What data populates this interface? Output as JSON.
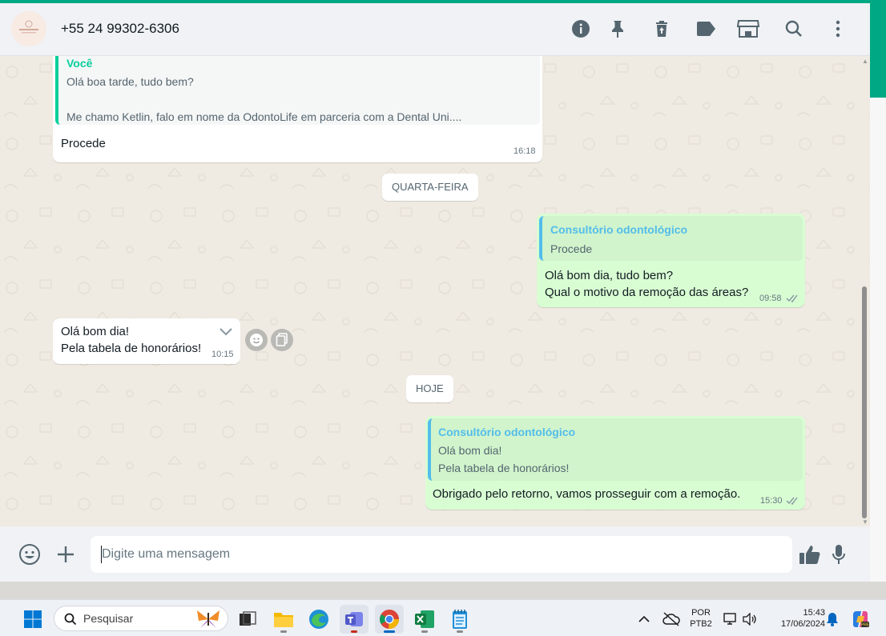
{
  "header": {
    "contact_name": "+55 24 99302-6306",
    "icons": [
      "info-icon",
      "pin-icon",
      "delete-icon",
      "label-icon",
      "store-icon",
      "search-icon",
      "menu-icon"
    ]
  },
  "messages": [
    {
      "id": "m1",
      "direction": "incoming",
      "quote_author": "Você",
      "quote_lines": [
        "Olá boa tarde, tudo bem?",
        "",
        "Me chamo Ketlin, falo em nome da OdontoLife em parceria com a Dental Uni...."
      ],
      "text": [
        "Procede"
      ],
      "time": "16:18"
    },
    {
      "id": "d1",
      "type": "date",
      "label": "QUARTA-FEIRA"
    },
    {
      "id": "m2",
      "direction": "outgoing",
      "quote_author": "Consultório odontológico",
      "quote_lines": [
        "Procede"
      ],
      "text": [
        "Olá bom dia, tudo bem?",
        "Qual o motivo da remoção das áreas?"
      ],
      "time": "09:58",
      "status": "read"
    },
    {
      "id": "m3",
      "direction": "incoming",
      "text": [
        "Olá bom dia!",
        "Pela tabela de honorários!"
      ],
      "time": "10:15"
    },
    {
      "id": "d2",
      "type": "date",
      "label": "HOJE"
    },
    {
      "id": "m4",
      "direction": "outgoing",
      "quote_author": "Consultório odontológico",
      "quote_lines": [
        "Olá bom dia!",
        "Pela tabela de honorários!"
      ],
      "text": [
        "Obrigado pelo retorno, vamos prosseguir com a remoção."
      ],
      "time": "15:30",
      "status": "read"
    }
  ],
  "composer": {
    "placeholder": "Digite uma mensagem",
    "value": ""
  },
  "taskbar": {
    "search_placeholder": "Pesquisar",
    "language": "POR",
    "keyboard": "PTB2",
    "time": "15:43",
    "date": "17/06/2024"
  },
  "colors": {
    "accent": "#00a884",
    "outgoing_bubble": "#d9fdd3",
    "incoming_bubble": "#ffffff",
    "chat_background": "#efeae2",
    "quote_author_incoming": "#06cf9c",
    "quote_author_outgoing": "#53bdeb"
  }
}
